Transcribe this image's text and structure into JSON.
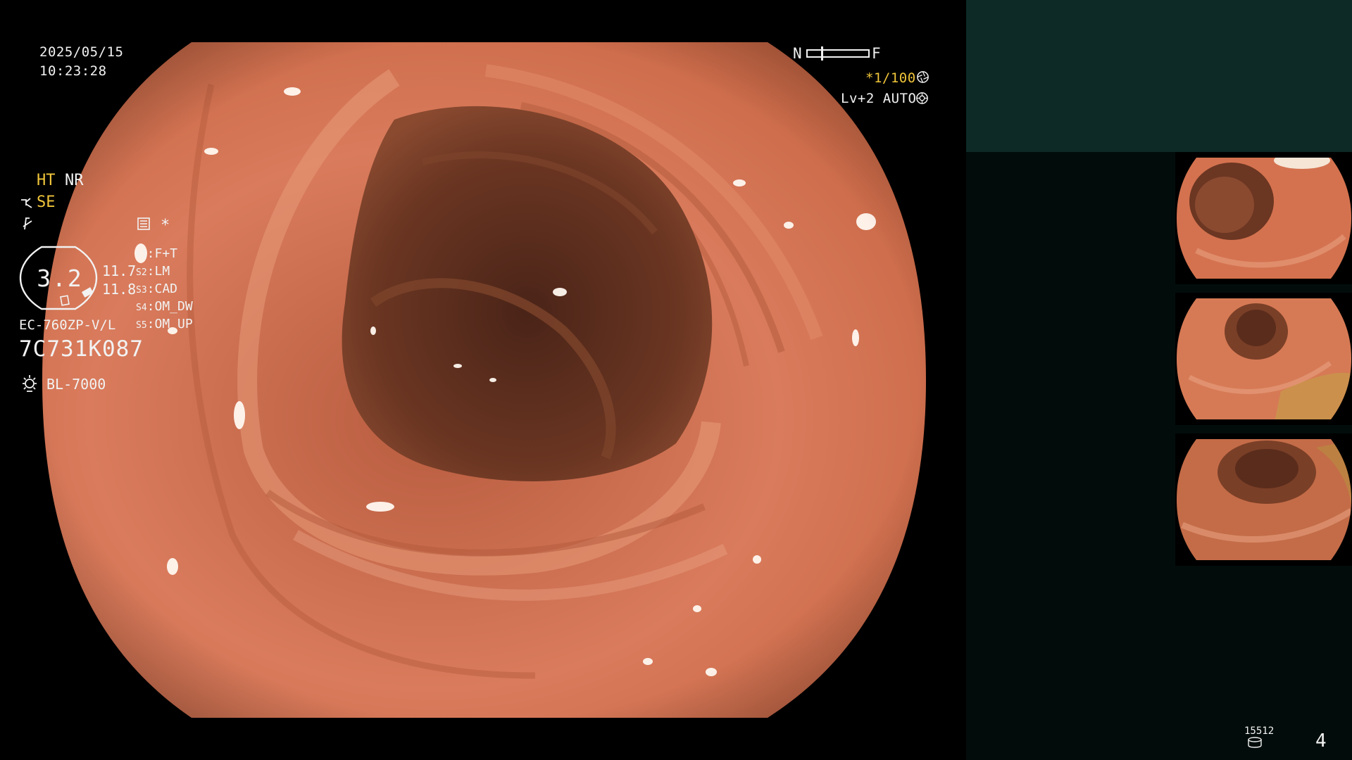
{
  "osd": {
    "date": "2025/05/15",
    "time": "10:23:28",
    "scale_near": "N",
    "scale_far": "F",
    "shutter": "*1/100",
    "shutter_icon": "aperture-icon",
    "light_level": "Lv+2 AUTO",
    "light_icon": "iris-icon"
  },
  "panel": {
    "ht": "HT",
    "nr": "NR",
    "se": "SE",
    "se_icon": "se-mode-icon",
    "edge_icon": "edge-enhance-icon",
    "screen_icon": "monitor-icon",
    "asterisk": "*",
    "zoom": {
      "value": "3.2",
      "reading_1": "11.7",
      "reading_2": "11.8"
    },
    "switches": [
      {
        "id": "S1",
        "label": "F+T"
      },
      {
        "id": "S2",
        "label": "LM"
      },
      {
        "id": "S3",
        "label": "CAD"
      },
      {
        "id": "S4",
        "label": "OM_DW"
      },
      {
        "id": "S5",
        "label": "OM_UP"
      }
    ],
    "scope_model": "EC-760ZP-V/L",
    "scope_serial": "7C731K087",
    "processor": "BL-7000",
    "lamp_icon": "lamp-icon",
    "counter": "15512",
    "counter_icon": "storage-icon",
    "page_number": "4"
  },
  "colors": {
    "osd_text": "#f2f2f2",
    "accent_amber": "#f0c53a",
    "panel_header": "#0e2a26",
    "panel_body": "#020d0b",
    "mucosa": "#d9795a",
    "lumen": "#4a2418"
  }
}
